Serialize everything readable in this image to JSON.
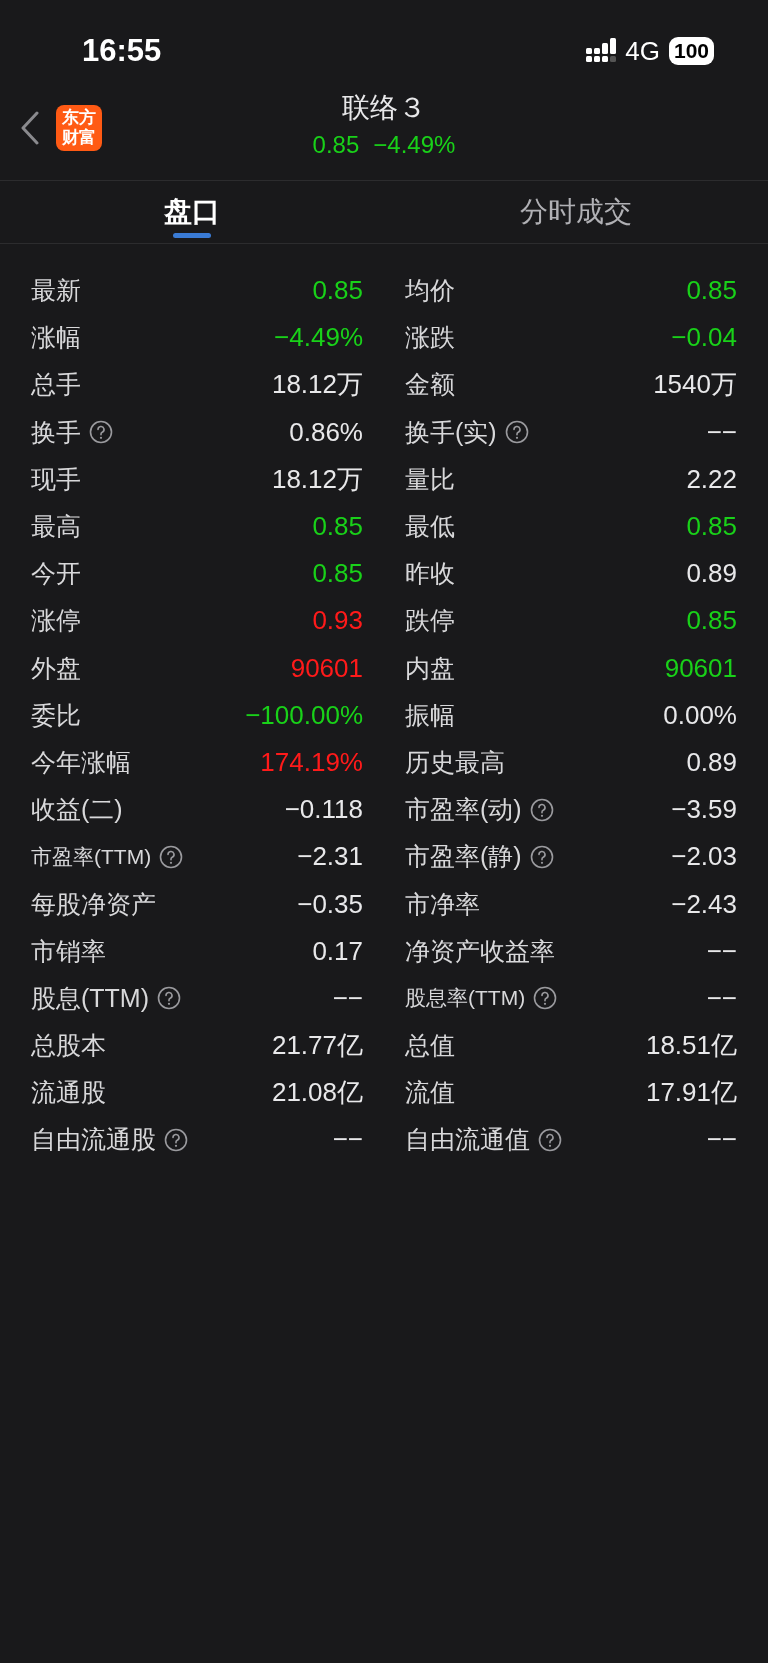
{
  "status_bar": {
    "time": "16:55",
    "network": "4G",
    "battery": "100"
  },
  "header": {
    "logo_lines": [
      "东方",
      "财富"
    ],
    "title": "联络３",
    "price": {
      "text": "0.85",
      "color": "#19d119"
    },
    "change": {
      "text": "−4.49%",
      "color": "#19d119"
    }
  },
  "tabs": [
    {
      "label": "盘口",
      "selected": true
    },
    {
      "label": "分时成交",
      "selected": false
    }
  ],
  "rows": [
    [
      {
        "label": "最新",
        "help": false,
        "small": false,
        "value": "0.85",
        "color": "#19d119"
      },
      {
        "label": "均价",
        "help": false,
        "small": false,
        "value": "0.85",
        "color": "#19d119"
      }
    ],
    [
      {
        "label": "涨幅",
        "help": false,
        "small": false,
        "value": "−4.49%",
        "color": "#19d119"
      },
      {
        "label": "涨跌",
        "help": false,
        "small": false,
        "value": "−0.04",
        "color": "#19d119"
      }
    ],
    [
      {
        "label": "总手",
        "help": false,
        "small": false,
        "value": "18.12万",
        "color": "#e8e8ea"
      },
      {
        "label": "金额",
        "help": false,
        "small": false,
        "value": "1540万",
        "color": "#e8e8ea"
      }
    ],
    [
      {
        "label": "换手",
        "help": true,
        "small": false,
        "value": "0.86%",
        "color": "#e8e8ea"
      },
      {
        "label": "换手(实)",
        "help": true,
        "small": false,
        "value": "−−",
        "color": "#e8e8ea"
      }
    ],
    [
      {
        "label": "现手",
        "help": false,
        "small": false,
        "value": "18.12万",
        "color": "#e8e8ea"
      },
      {
        "label": "量比",
        "help": false,
        "small": false,
        "value": "2.22",
        "color": "#e8e8ea"
      }
    ],
    [
      {
        "label": "最高",
        "help": false,
        "small": false,
        "value": "0.85",
        "color": "#19d119"
      },
      {
        "label": "最低",
        "help": false,
        "small": false,
        "value": "0.85",
        "color": "#19d119"
      }
    ],
    [
      {
        "label": "今开",
        "help": false,
        "small": false,
        "value": "0.85",
        "color": "#19d119"
      },
      {
        "label": "昨收",
        "help": false,
        "small": false,
        "value": "0.89",
        "color": "#e8e8ea"
      }
    ],
    [
      {
        "label": "涨停",
        "help": false,
        "small": false,
        "value": "0.93",
        "color": "#ff1a1a"
      },
      {
        "label": "跌停",
        "help": false,
        "small": false,
        "value": "0.85",
        "color": "#19d119"
      }
    ],
    [
      {
        "label": "外盘",
        "help": false,
        "small": false,
        "value": "90601",
        "color": "#ff1a1a"
      },
      {
        "label": "内盘",
        "help": false,
        "small": false,
        "value": "90601",
        "color": "#19d119"
      }
    ],
    [
      {
        "label": "委比",
        "help": false,
        "small": false,
        "value": "−100.00%",
        "color": "#19d119"
      },
      {
        "label": "振幅",
        "help": false,
        "small": false,
        "value": "0.00%",
        "color": "#e8e8ea"
      }
    ],
    [
      {
        "label": "今年涨幅",
        "help": false,
        "small": false,
        "value": "174.19%",
        "color": "#ff1a1a"
      },
      {
        "label": "历史最高",
        "help": false,
        "small": false,
        "value": "0.89",
        "color": "#e8e8ea"
      }
    ],
    [
      {
        "label": "收益(二)",
        "help": false,
        "small": false,
        "value": "−0.118",
        "color": "#e8e8ea"
      },
      {
        "label": "市盈率(动)",
        "help": true,
        "small": false,
        "value": "−3.59",
        "color": "#e8e8ea"
      }
    ],
    [
      {
        "label": "市盈率(TTM)",
        "help": true,
        "small": true,
        "value": "−2.31",
        "color": "#e8e8ea"
      },
      {
        "label": "市盈率(静)",
        "help": true,
        "small": false,
        "value": "−2.03",
        "color": "#e8e8ea"
      }
    ],
    [
      {
        "label": "每股净资产",
        "help": false,
        "small": false,
        "value": "−0.35",
        "color": "#e8e8ea"
      },
      {
        "label": "市净率",
        "help": false,
        "small": false,
        "value": "−2.43",
        "color": "#e8e8ea"
      }
    ],
    [
      {
        "label": "市销率",
        "help": false,
        "small": false,
        "value": "0.17",
        "color": "#e8e8ea"
      },
      {
        "label": "净资产收益率",
        "help": false,
        "small": false,
        "value": "−−",
        "color": "#e8e8ea"
      }
    ],
    [
      {
        "label": "股息(TTM)",
        "help": true,
        "small": false,
        "value": "−−",
        "color": "#e8e8ea"
      },
      {
        "label": "股息率(TTM)",
        "help": true,
        "small": true,
        "value": "−−",
        "color": "#e8e8ea"
      }
    ],
    [
      {
        "label": "总股本",
        "help": false,
        "small": false,
        "value": "21.77亿",
        "color": "#e8e8ea"
      },
      {
        "label": "总值",
        "help": false,
        "small": false,
        "value": "18.51亿",
        "color": "#e8e8ea"
      }
    ],
    [
      {
        "label": "流通股",
        "help": false,
        "small": false,
        "value": "21.08亿",
        "color": "#e8e8ea"
      },
      {
        "label": "流值",
        "help": false,
        "small": false,
        "value": "17.91亿",
        "color": "#e8e8ea"
      }
    ],
    [
      {
        "label": "自由流通股",
        "help": true,
        "small": false,
        "value": "−−",
        "color": "#e8e8ea"
      },
      {
        "label": "自由流通值",
        "help": true,
        "small": false,
        "value": "−−",
        "color": "#e8e8ea"
      }
    ]
  ]
}
